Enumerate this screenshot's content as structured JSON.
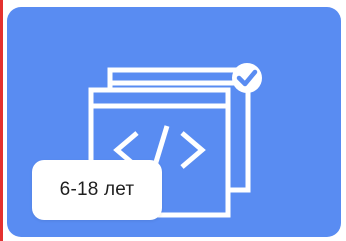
{
  "card": {
    "age_range": "6-18 лет",
    "icon": "code-window-check-icon",
    "background_color": "#598cf2",
    "badge_color": "#ffffff",
    "icon_color": "#ffffff"
  }
}
